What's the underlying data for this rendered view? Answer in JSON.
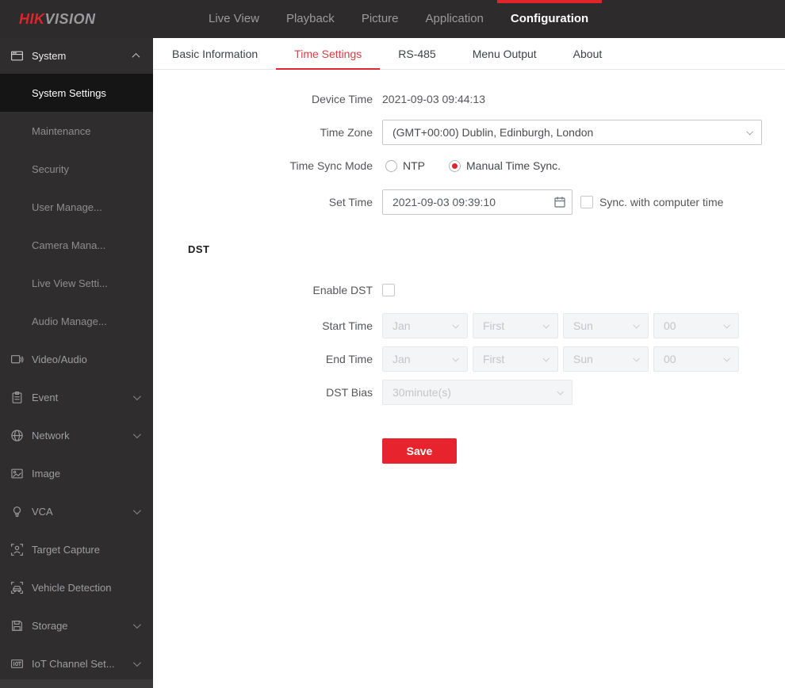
{
  "colors": {
    "accent": "#e0242c",
    "tab_active": "#dc3c43",
    "topbar_bg": "#2d2b2c",
    "sidebar_bg": "#2f2d2e"
  },
  "topnav": {
    "logo_hik": "HIK",
    "logo_vision": "VISION",
    "items": [
      {
        "label": "Live View",
        "active": false
      },
      {
        "label": "Playback",
        "active": false
      },
      {
        "label": "Picture",
        "active": false
      },
      {
        "label": "Application",
        "active": false
      },
      {
        "label": "Configuration",
        "active": true
      }
    ]
  },
  "sidebar": {
    "system_group": {
      "label": "System",
      "expanded": true
    },
    "sub_items": [
      {
        "label": "System Settings",
        "active": true
      },
      {
        "label": "Maintenance",
        "active": false
      },
      {
        "label": "Security",
        "active": false
      },
      {
        "label": "User Manage...",
        "active": false
      },
      {
        "label": "Camera Mana...",
        "active": false
      },
      {
        "label": "Live View Setti...",
        "active": false
      },
      {
        "label": "Audio Manage...",
        "active": false
      }
    ],
    "items": [
      {
        "label": "Video/Audio",
        "icon": "video-audio-icon",
        "expandable": false
      },
      {
        "label": "Event",
        "icon": "event-icon",
        "expandable": true
      },
      {
        "label": "Network",
        "icon": "network-icon",
        "expandable": true
      },
      {
        "label": "Image",
        "icon": "image-icon",
        "expandable": false
      },
      {
        "label": "VCA",
        "icon": "vca-icon",
        "expandable": true
      },
      {
        "label": "Target Capture",
        "icon": "target-capture-icon",
        "expandable": false
      },
      {
        "label": "Vehicle Detection",
        "icon": "vehicle-detection-icon",
        "expandable": false
      },
      {
        "label": "Storage",
        "icon": "storage-icon",
        "expandable": true
      },
      {
        "label": "IoT Channel Set...",
        "icon": "iot-channel-icon",
        "expandable": true
      }
    ]
  },
  "tabs": [
    {
      "label": "Basic Information",
      "active": false
    },
    {
      "label": "Time Settings",
      "active": true
    },
    {
      "label": "RS-485",
      "active": false
    },
    {
      "label": "Menu Output",
      "active": false
    },
    {
      "label": "About",
      "active": false
    }
  ],
  "form": {
    "device_time": {
      "label": "Device Time",
      "value": "2021-09-03 09:44:13"
    },
    "time_zone": {
      "label": "Time Zone",
      "value": "(GMT+00:00) Dublin, Edinburgh, London"
    },
    "time_sync_mode": {
      "label": "Time Sync Mode",
      "options": [
        {
          "label": "NTP",
          "selected": false
        },
        {
          "label": "Manual Time Sync.",
          "selected": true
        }
      ]
    },
    "set_time": {
      "label": "Set Time",
      "value": "2021-09-03 09:39:10",
      "sync_checkbox_label": "Sync. with computer time",
      "sync_checked": false
    },
    "dst": {
      "heading": "DST",
      "enable_label": "Enable DST",
      "enabled": false,
      "start_time": {
        "label": "Start Time",
        "month": "Jan",
        "week": "First",
        "day": "Sun",
        "hour": "00"
      },
      "end_time": {
        "label": "End Time",
        "month": "Jan",
        "week": "First",
        "day": "Sun",
        "hour": "00"
      },
      "bias": {
        "label": "DST Bias",
        "value": "30minute(s)"
      }
    },
    "save_label": "Save"
  }
}
